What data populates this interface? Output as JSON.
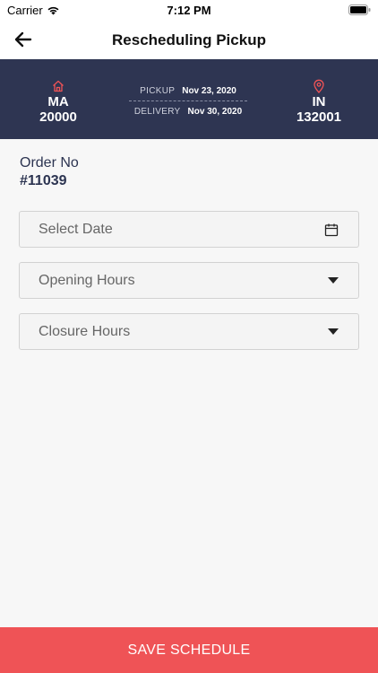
{
  "status_bar": {
    "carrier": "Carrier",
    "time": "7:12 PM",
    "wifi_icon": "wifi-icon",
    "battery_icon": "battery-icon"
  },
  "nav": {
    "title": "Rescheduling Pickup",
    "back_icon": "arrow-left-icon"
  },
  "route": {
    "from": {
      "code": "MA",
      "zip": "20000",
      "icon": "home-icon"
    },
    "to": {
      "code": "IN",
      "zip": "132001",
      "icon": "location-pin-icon"
    },
    "pickup": {
      "label": "PICKUP",
      "date": "Nov 23, 2020"
    },
    "delivery": {
      "label": "DELIVERY",
      "date": "Nov 30, 2020"
    }
  },
  "order": {
    "label": "Order No",
    "number": "#11039"
  },
  "form": {
    "date": {
      "placeholder": "Select Date",
      "icon": "calendar-icon"
    },
    "opening": {
      "placeholder": "Opening Hours",
      "icon": "caret-down-icon"
    },
    "closure": {
      "placeholder": "Closure Hours",
      "icon": "caret-down-icon"
    }
  },
  "save_label": "SAVE SCHEDULE",
  "colors": {
    "navy": "#2e3552",
    "accent": "#ef5356",
    "text": "#2c3451"
  }
}
